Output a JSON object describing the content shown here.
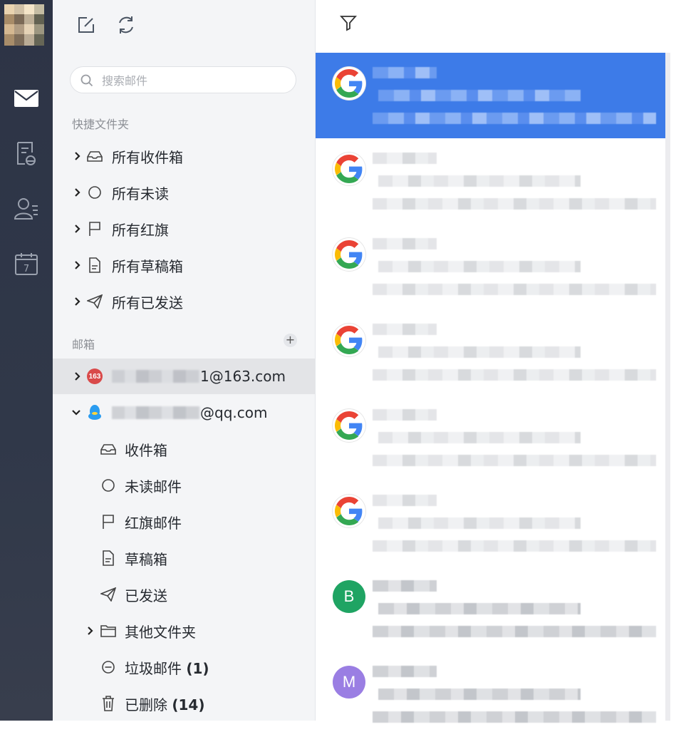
{
  "rail": {
    "icons": [
      "mail-icon",
      "notes-icon",
      "contacts-icon",
      "calendar-icon"
    ],
    "calendar_day": "7"
  },
  "toolbar": {
    "icons": [
      "compose-icon",
      "refresh-icon"
    ]
  },
  "search": {
    "placeholder": "搜索邮件"
  },
  "quick": {
    "label": "快捷文件夹",
    "items": [
      {
        "label": "所有收件箱",
        "icon": "inbox-icon"
      },
      {
        "label": "所有未读",
        "icon": "circle-icon"
      },
      {
        "label": "所有红旗",
        "icon": "flag-icon"
      },
      {
        "label": "所有草稿箱",
        "icon": "draft-icon"
      },
      {
        "label": "所有已发送",
        "icon": "send-icon"
      }
    ]
  },
  "mailboxes": {
    "label": "邮箱",
    "add": "+",
    "accounts": [
      {
        "suffix": "1@163.com",
        "badge": "163",
        "expanded": false
      },
      {
        "suffix": "@qq.com",
        "expanded": true
      }
    ],
    "qq_folders": [
      {
        "label": "收件箱",
        "icon": "inbox-icon"
      },
      {
        "label": "未读邮件",
        "icon": "circle-icon"
      },
      {
        "label": "红旗邮件",
        "icon": "flag-icon"
      },
      {
        "label": "草稿箱",
        "icon": "draft-icon"
      },
      {
        "label": "已发送",
        "icon": "send-icon"
      },
      {
        "label": "其他文件夹",
        "icon": "folder-icon"
      },
      {
        "label": "垃圾邮件",
        "count": "(1)",
        "icon": "minus-circle-icon"
      },
      {
        "label": "已删除",
        "count": "(14)",
        "icon": "trash-icon"
      }
    ]
  },
  "messages": [
    {
      "avatar": "G",
      "kind": "google",
      "selected": true
    },
    {
      "avatar": "G",
      "kind": "google"
    },
    {
      "avatar": "G",
      "kind": "google"
    },
    {
      "avatar": "G",
      "kind": "google"
    },
    {
      "avatar": "G",
      "kind": "google"
    },
    {
      "avatar": "G",
      "kind": "google"
    },
    {
      "avatar": "B",
      "kind": "letter",
      "color": "#1fa463"
    },
    {
      "avatar": "M",
      "kind": "letter",
      "color": "#9a7ee3"
    }
  ],
  "colors": {
    "accent": "#3d7be8",
    "rail": "#2f3647",
    "pane": "#f4f5f7"
  }
}
